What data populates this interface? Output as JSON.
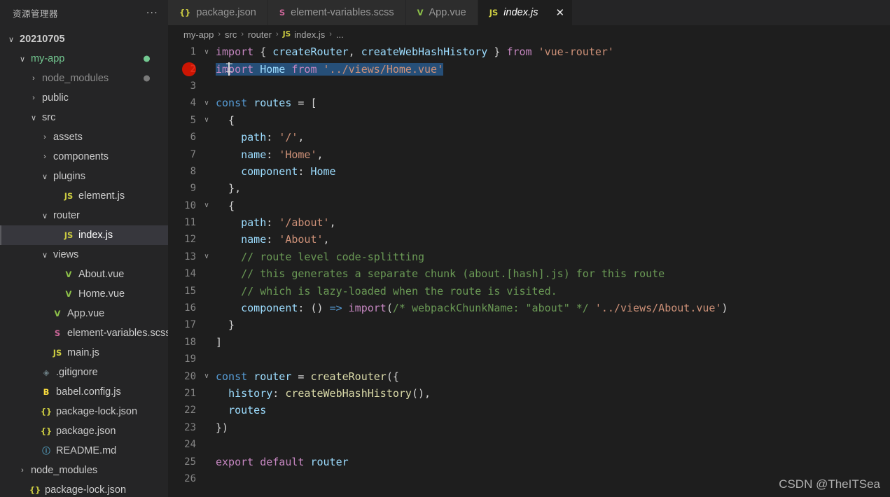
{
  "sidebar": {
    "title": "资源管理器",
    "more_actions": "...",
    "items": [
      {
        "label": "20210705",
        "indent": 0,
        "chev": "∨",
        "icon": "",
        "icon_color": "",
        "text_color": "#cccccc",
        "bold": true,
        "dot": "",
        "selected": false,
        "name": "tree-item-20210705"
      },
      {
        "label": "my-app",
        "indent": 1,
        "chev": "∨",
        "icon": "",
        "icon_color": "",
        "text_color": "#73c991",
        "bold": false,
        "dot": "#73c991",
        "selected": false,
        "name": "tree-item-my-app"
      },
      {
        "label": "node_modules",
        "indent": 2,
        "chev": "›",
        "icon": "",
        "icon_color": "",
        "text_color": "#8c8c8c",
        "bold": false,
        "dot": "#7a7a7a",
        "selected": false,
        "name": "tree-item-node-modules"
      },
      {
        "label": "public",
        "indent": 2,
        "chev": "›",
        "icon": "",
        "icon_color": "",
        "text_color": "#cccccc",
        "bold": false,
        "dot": "",
        "selected": false,
        "name": "tree-item-public"
      },
      {
        "label": "src",
        "indent": 2,
        "chev": "∨",
        "icon": "",
        "icon_color": "",
        "text_color": "#cccccc",
        "bold": false,
        "dot": "",
        "selected": false,
        "name": "tree-item-src"
      },
      {
        "label": "assets",
        "indent": 3,
        "chev": "›",
        "icon": "",
        "icon_color": "",
        "text_color": "#cccccc",
        "bold": false,
        "dot": "",
        "selected": false,
        "name": "tree-item-assets"
      },
      {
        "label": "components",
        "indent": 3,
        "chev": "›",
        "icon": "",
        "icon_color": "",
        "text_color": "#cccccc",
        "bold": false,
        "dot": "",
        "selected": false,
        "name": "tree-item-components"
      },
      {
        "label": "plugins",
        "indent": 3,
        "chev": "∨",
        "icon": "",
        "icon_color": "",
        "text_color": "#cccccc",
        "bold": false,
        "dot": "",
        "selected": false,
        "name": "tree-item-plugins"
      },
      {
        "label": "element.js",
        "indent": 4,
        "chev": "",
        "icon": "JS",
        "icon_color": "#cbcb41",
        "text_color": "#cccccc",
        "bold": false,
        "dot": "",
        "selected": false,
        "name": "tree-item-element-js"
      },
      {
        "label": "router",
        "indent": 3,
        "chev": "∨",
        "icon": "",
        "icon_color": "",
        "text_color": "#cccccc",
        "bold": false,
        "dot": "",
        "selected": false,
        "name": "tree-item-router"
      },
      {
        "label": "index.js",
        "indent": 4,
        "chev": "",
        "icon": "JS",
        "icon_color": "#cbcb41",
        "text_color": "#ffffff",
        "bold": false,
        "dot": "",
        "selected": true,
        "name": "tree-item-index-js"
      },
      {
        "label": "views",
        "indent": 3,
        "chev": "∨",
        "icon": "",
        "icon_color": "",
        "text_color": "#cccccc",
        "bold": false,
        "dot": "",
        "selected": false,
        "name": "tree-item-views"
      },
      {
        "label": "About.vue",
        "indent": 4,
        "chev": "",
        "icon": "V",
        "icon_color": "#8dc149",
        "text_color": "#cccccc",
        "bold": false,
        "dot": "",
        "selected": false,
        "name": "tree-item-about-vue"
      },
      {
        "label": "Home.vue",
        "indent": 4,
        "chev": "",
        "icon": "V",
        "icon_color": "#8dc149",
        "text_color": "#cccccc",
        "bold": false,
        "dot": "",
        "selected": false,
        "name": "tree-item-home-vue"
      },
      {
        "label": "App.vue",
        "indent": 3,
        "chev": "",
        "icon": "V",
        "icon_color": "#8dc149",
        "text_color": "#cccccc",
        "bold": false,
        "dot": "",
        "selected": false,
        "name": "tree-item-app-vue"
      },
      {
        "label": "element-variables.scss",
        "indent": 3,
        "chev": "",
        "icon": "S",
        "icon_color": "#cc6699",
        "text_color": "#cccccc",
        "bold": false,
        "dot": "",
        "selected": false,
        "name": "tree-item-element-variables-scss"
      },
      {
        "label": "main.js",
        "indent": 3,
        "chev": "",
        "icon": "JS",
        "icon_color": "#cbcb41",
        "text_color": "#cccccc",
        "bold": false,
        "dot": "",
        "selected": false,
        "name": "tree-item-main-js"
      },
      {
        "label": ".gitignore",
        "indent": 2,
        "chev": "",
        "icon": "◈",
        "icon_color": "#6d8086",
        "text_color": "#cccccc",
        "bold": false,
        "dot": "",
        "selected": false,
        "name": "tree-item-gitignore"
      },
      {
        "label": "babel.config.js",
        "indent": 2,
        "chev": "",
        "icon": "B",
        "icon_color": "#f9dc3e",
        "text_color": "#cccccc",
        "bold": false,
        "dot": "",
        "selected": false,
        "name": "tree-item-babel-config-js"
      },
      {
        "label": "package-lock.json",
        "indent": 2,
        "chev": "",
        "icon": "{}",
        "icon_color": "#cbcb41",
        "text_color": "#cccccc",
        "bold": false,
        "dot": "",
        "selected": false,
        "name": "tree-item-package-lock-json"
      },
      {
        "label": "package.json",
        "indent": 2,
        "chev": "",
        "icon": "{}",
        "icon_color": "#cbcb41",
        "text_color": "#cccccc",
        "bold": false,
        "dot": "",
        "selected": false,
        "name": "tree-item-package-json"
      },
      {
        "label": "README.md",
        "indent": 2,
        "chev": "",
        "icon": "ⓘ",
        "icon_color": "#519aba",
        "text_color": "#cccccc",
        "bold": false,
        "dot": "",
        "selected": false,
        "name": "tree-item-readme-md"
      },
      {
        "label": "node_modules",
        "indent": 1,
        "chev": "›",
        "icon": "",
        "icon_color": "",
        "text_color": "#cccccc",
        "bold": false,
        "dot": "",
        "selected": false,
        "name": "tree-item-node-modules-root"
      },
      {
        "label": "package-lock.json",
        "indent": 1,
        "chev": "",
        "icon": "{}",
        "icon_color": "#cbcb41",
        "text_color": "#cccccc",
        "bold": false,
        "dot": "",
        "selected": false,
        "name": "tree-item-package-lock-json-root"
      }
    ]
  },
  "tabs": [
    {
      "label": "package.json",
      "icon": "{}",
      "icon_color": "#cbcb41",
      "active": false,
      "name": "tab-package-json"
    },
    {
      "label": "element-variables.scss",
      "icon": "S",
      "icon_color": "#cc6699",
      "active": false,
      "name": "tab-element-variables-scss"
    },
    {
      "label": "App.vue",
      "icon": "V",
      "icon_color": "#8dc149",
      "active": false,
      "name": "tab-app-vue"
    },
    {
      "label": "index.js",
      "icon": "JS",
      "icon_color": "#cbcb41",
      "active": true,
      "name": "tab-index-js"
    }
  ],
  "tab_close_label": "✕",
  "breadcrumb": {
    "parts": [
      "my-app",
      "src",
      "router",
      "index.js",
      "..."
    ],
    "file_icon": "JS",
    "separator": "›"
  },
  "editor": {
    "lines": [
      {
        "n": "1",
        "fold": "∨",
        "current": false
      },
      {
        "n": "2",
        "fold": "",
        "current": true
      },
      {
        "n": "3",
        "fold": "",
        "current": false
      },
      {
        "n": "4",
        "fold": "∨",
        "current": false
      },
      {
        "n": "5",
        "fold": "∨",
        "current": false
      },
      {
        "n": "6",
        "fold": "",
        "current": false
      },
      {
        "n": "7",
        "fold": "",
        "current": false
      },
      {
        "n": "8",
        "fold": "",
        "current": false
      },
      {
        "n": "9",
        "fold": "",
        "current": false
      },
      {
        "n": "10",
        "fold": "∨",
        "current": false
      },
      {
        "n": "11",
        "fold": "",
        "current": false
      },
      {
        "n": "12",
        "fold": "",
        "current": false
      },
      {
        "n": "13",
        "fold": "∨",
        "current": false
      },
      {
        "n": "14",
        "fold": "",
        "current": false
      },
      {
        "n": "15",
        "fold": "",
        "current": false
      },
      {
        "n": "16",
        "fold": "",
        "current": false
      },
      {
        "n": "17",
        "fold": "",
        "current": false
      },
      {
        "n": "18",
        "fold": "",
        "current": false
      },
      {
        "n": "19",
        "fold": "",
        "current": false
      },
      {
        "n": "20",
        "fold": "∨",
        "current": false
      },
      {
        "n": "21",
        "fold": "",
        "current": false
      },
      {
        "n": "22",
        "fold": "",
        "current": false
      },
      {
        "n": "23",
        "fold": "",
        "current": false
      },
      {
        "n": "24",
        "fold": "",
        "current": false
      },
      {
        "n": "25",
        "fold": "",
        "current": false
      },
      {
        "n": "26",
        "fold": "",
        "current": false
      }
    ],
    "text": {
      "l1": "import { createRouter, createWebHashHistory } from 'vue-router'",
      "l2": "import Home from '../views/Home.vue'",
      "l4": "const routes = [",
      "l5": "  {",
      "l6": "    path: '/',",
      "l7": "    name: 'Home',",
      "l8": "    component: Home",
      "l9": "  },",
      "l10": "  {",
      "l11": "    path: '/about',",
      "l12": "    name: 'About',",
      "l13": "    // route level code-splitting",
      "l14": "    // this generates a separate chunk (about.[hash].js) for this route",
      "l15": "    // which is lazy-loaded when the route is visited.",
      "l16": "    component: () => import(/* webpackChunkName: \"about\" */ '../views/About.vue')",
      "l17": "  }",
      "l18": "]",
      "l20": "const router = createRouter({",
      "l21": "  history: createWebHashHistory(),",
      "l22": "  routes",
      "l23": "})",
      "l25": "export default router"
    },
    "breakpoint_line": "2",
    "selected_line": "2"
  },
  "watermark": "CSDN @TheITSea",
  "colors": {
    "selection": "#264f78",
    "breakpoint": "#e51400",
    "accent_green": "#73c991"
  }
}
